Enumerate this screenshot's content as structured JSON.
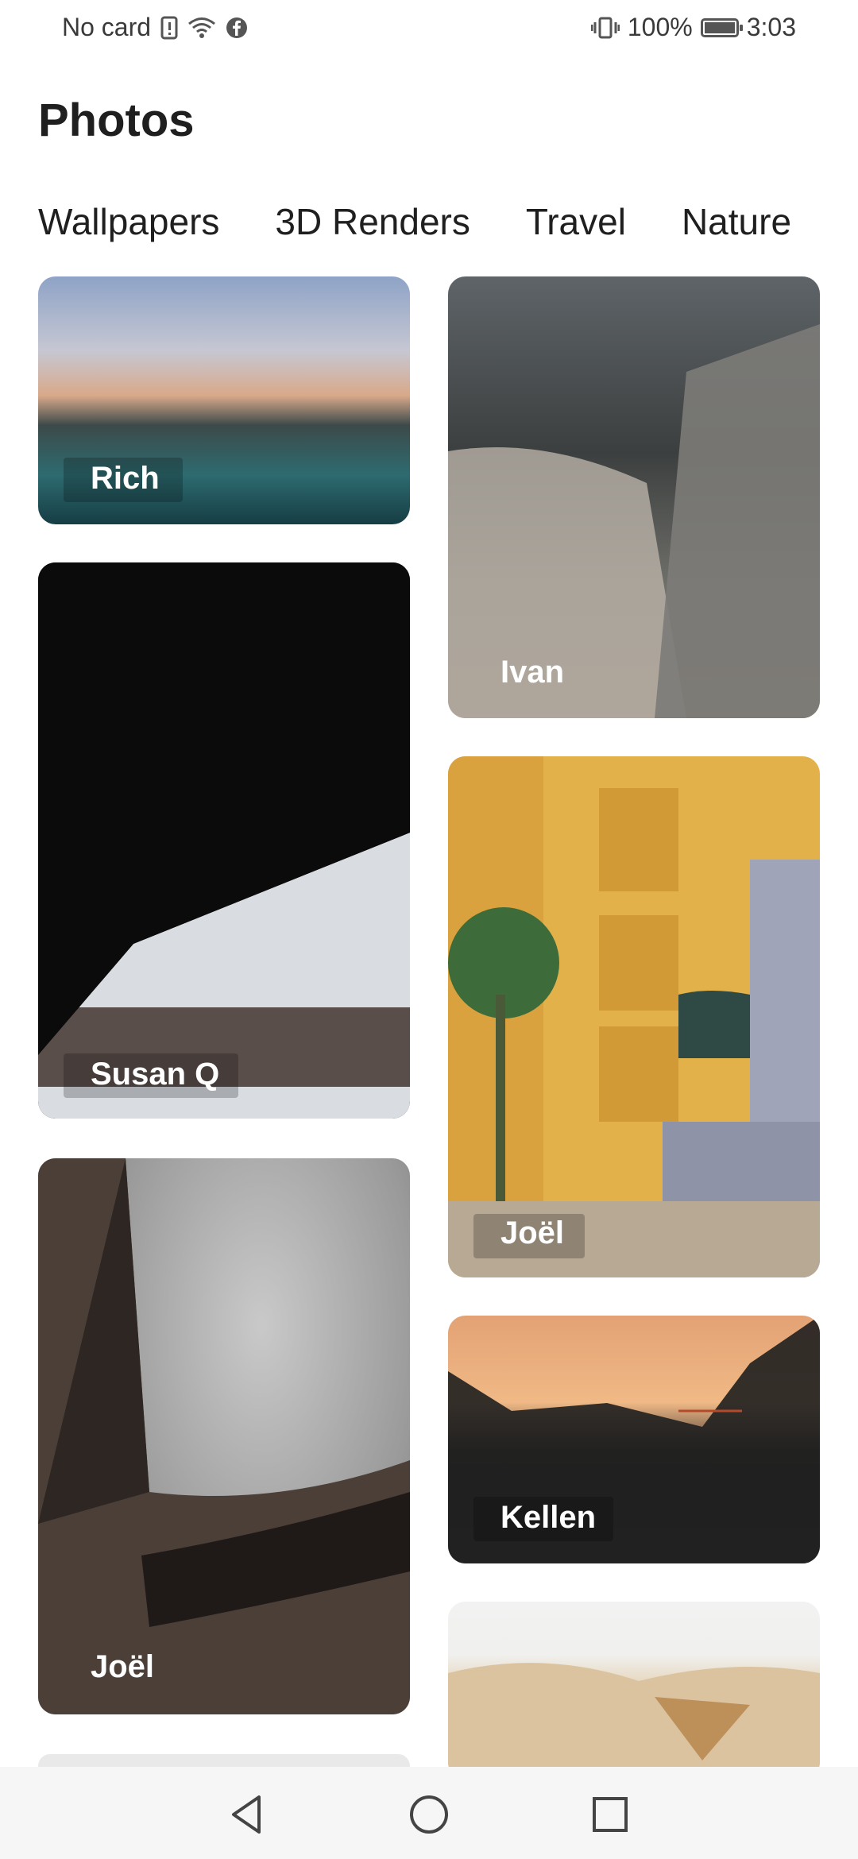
{
  "status_bar": {
    "carrier": "No card",
    "battery_percent": "100%",
    "time": "3:03",
    "icons": [
      "sim-alert-icon",
      "wifi-icon",
      "facebook-icon",
      "vibrate-icon",
      "battery-icon"
    ]
  },
  "header": {
    "title": "Photos"
  },
  "tabs": [
    {
      "label": "Wallpapers"
    },
    {
      "label": "3D Renders"
    },
    {
      "label": "Travel"
    },
    {
      "label": "Nature"
    }
  ],
  "photos": [
    {
      "author": "Rich"
    },
    {
      "author": "Susan Q"
    },
    {
      "author": "Joël"
    },
    {
      "author": "Ivan"
    },
    {
      "author": "Joël"
    },
    {
      "author": "Kellen"
    },
    {
      "author": ""
    }
  ],
  "nav": {
    "icons": [
      "back-icon",
      "home-icon",
      "recents-icon"
    ]
  }
}
